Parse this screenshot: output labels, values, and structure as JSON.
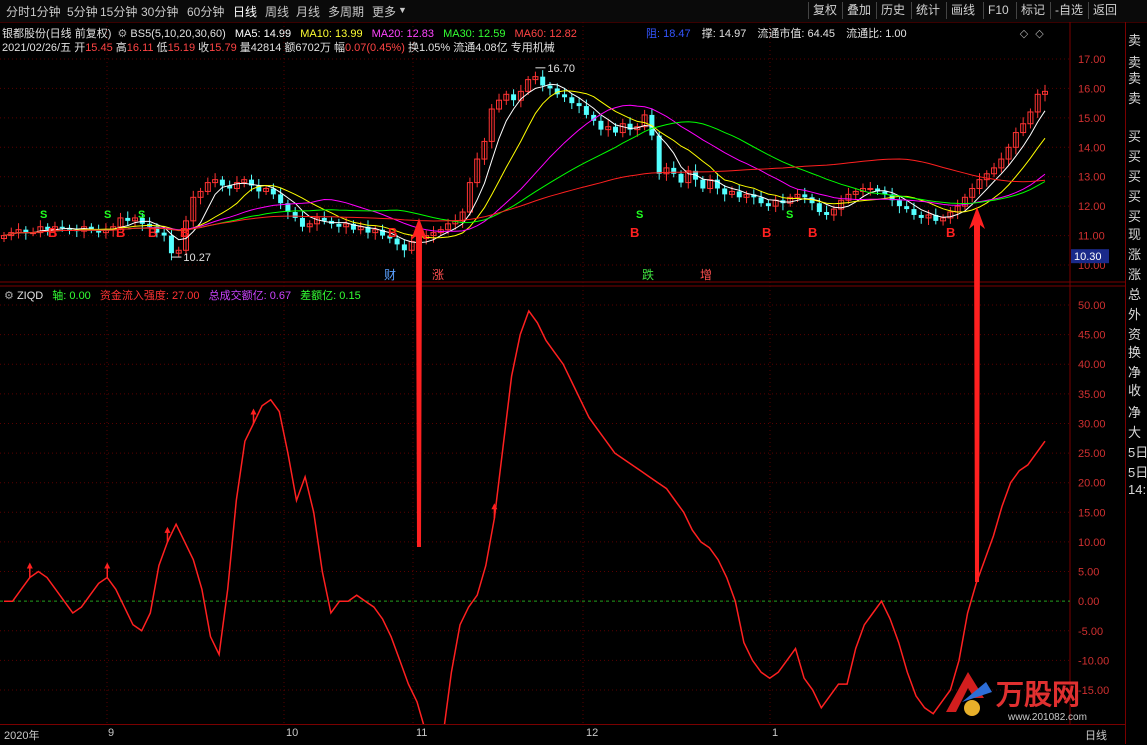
{
  "toolbar": {
    "periods": [
      "分时",
      "1分钟",
      "5分钟",
      "15分钟",
      "30分钟",
      "60分钟",
      "日线",
      "周线",
      "月线",
      "多周期",
      "更多"
    ],
    "active_period": "日线",
    "buttons": [
      "复权",
      "叠加",
      "历史",
      "统计",
      "画线",
      "F10",
      "标记",
      "-自选",
      "返回"
    ]
  },
  "header": {
    "stock_title": "银都股份(日线 前复权)",
    "bs5_label": "BS5(5,10,20,30,60)",
    "ma5": "MA5: 14.99",
    "ma10": "MA10: 13.99",
    "ma20": "MA20: 12.83",
    "ma30": "MA30: 12.59",
    "ma60": "MA60: 12.82",
    "resist": "阻: 18.47",
    "support": "撑: 14.97",
    "mktcap": "流通市值: 64.45",
    "circ_ratio": "流通比: 1.00",
    "date": "2021/02/26/五",
    "open_lbl": "开",
    "open": "15.45",
    "high_lbl": "高",
    "high": "16.11",
    "low_lbl": "低",
    "low": "15.19",
    "close_lbl": "收",
    "close": "15.79",
    "vol": "量42814",
    "amount": "额6702万",
    "chg_lbl": "幅",
    "chg": "0.07(0.45%)",
    "turnover": "换1.05%",
    "float": "流通4.08亿",
    "sector": "专用机械"
  },
  "indicator": {
    "name": "ZIQD",
    "axis": "轴: 0.00",
    "inflow": "资金流入强度: 27.00",
    "total": "总成交额亿: 0.67",
    "diff": "差额亿: 0.15"
  },
  "price_axis": [
    "17.00",
    "16.00",
    "15.00",
    "14.00",
    "13.00",
    "12.00",
    "11.00",
    "10.00"
  ],
  "current_price_tag": "10.30",
  "ind_axis": [
    "50.00",
    "45.00",
    "40.00",
    "35.00",
    "30.00",
    "25.00",
    "20.00",
    "15.00",
    "10.00",
    "5.00",
    "0.00",
    "-5.00",
    "-10.00",
    "-15.00"
  ],
  "date_axis": [
    "2020年",
    "9",
    "10",
    "11",
    "12",
    "1"
  ],
  "price_marks": {
    "high": "16.70",
    "low": "10.27"
  },
  "event_labels": [
    {
      "text": "财",
      "color": "#5aa0ff"
    },
    {
      "text": "涨",
      "color": "#ff5050"
    },
    {
      "text": "跌",
      "color": "#40e040"
    },
    {
      "text": "增",
      "color": "#ff5050"
    }
  ],
  "right_panel": [
    "卖",
    "卖",
    "卖",
    "卖",
    "买",
    "买",
    "买",
    "买",
    "买",
    "现",
    "涨",
    "涨",
    "总",
    "外",
    "资",
    "换",
    "净",
    "收",
    "净",
    "大",
    "5日",
    "5日",
    "14:"
  ],
  "bottom_tabs": [
    "日线"
  ],
  "logo_text": "万股网",
  "logo_url": "www.201082.com",
  "colors": {
    "up": "#ff3333",
    "down": "#54ffff",
    "ma5": "#ffffff",
    "ma10": "#ffff00",
    "ma20": "#ff00ff",
    "ma30": "#00ff00",
    "ma60": "#ff2020",
    "ziqd": "#ff2020",
    "grid": "#7a0000"
  },
  "chart_data": [
    {
      "type": "candlestick",
      "title": "银都股份(日线 前复权)",
      "yaxis_ticks": [
        17,
        16,
        15,
        14,
        13,
        12,
        11,
        10
      ],
      "ylim": [
        9.6,
        17.8
      ],
      "close_series": [
        11.0,
        11.1,
        11.2,
        11.1,
        11.1,
        11.3,
        11.2,
        11.3,
        11.25,
        11.2,
        11.15,
        11.3,
        11.2,
        11.1,
        11.2,
        11.3,
        11.6,
        11.5,
        11.6,
        11.4,
        11.3,
        11.1,
        11.0,
        10.4,
        10.5,
        11.5,
        12.3,
        12.5,
        12.8,
        12.9,
        12.7,
        12.6,
        12.8,
        12.9,
        12.7,
        12.5,
        12.6,
        12.4,
        12.1,
        11.8,
        11.6,
        11.3,
        11.4,
        11.6,
        11.5,
        11.4,
        11.3,
        11.4,
        11.2,
        11.3,
        11.1,
        11.2,
        11.0,
        10.9,
        10.7,
        10.5,
        10.8,
        10.9,
        11.0,
        11.1,
        11.2,
        11.4,
        11.5,
        11.8,
        12.8,
        13.6,
        14.2,
        15.3,
        15.6,
        15.8,
        15.6,
        15.9,
        16.3,
        16.4,
        16.1,
        16.0,
        15.8,
        15.7,
        15.5,
        15.4,
        15.1,
        14.9,
        14.6,
        14.7,
        14.5,
        14.8,
        14.6,
        14.7,
        15.1,
        14.4,
        13.1,
        13.3,
        13.1,
        12.8,
        13.2,
        12.9,
        12.6,
        12.9,
        12.6,
        12.4,
        12.5,
        12.3,
        12.4,
        12.3,
        12.1,
        12.0,
        12.2,
        12.1,
        12.3,
        12.4,
        12.3,
        12.1,
        11.8,
        11.7,
        11.9,
        12.2,
        12.4,
        12.5,
        12.6,
        12.6,
        12.5,
        12.4,
        12.2,
        12.0,
        11.9,
        11.7,
        11.6,
        11.7,
        11.5,
        11.6,
        11.8,
        12.0,
        12.3,
        12.6,
        12.9,
        13.1,
        13.3,
        13.6,
        14.0,
        14.5,
        14.8,
        15.2,
        15.8,
        15.9
      ],
      "ma_params": [
        5,
        10,
        20,
        30,
        60
      ],
      "annotations": [
        "16.70",
        "10.27"
      ]
    },
    {
      "type": "line",
      "title": "ZIQD",
      "series": [
        {
          "name": "资金流入强度",
          "values": [
            0,
            0,
            2,
            4,
            5,
            4,
            2,
            0,
            -2,
            -1,
            1,
            3,
            4,
            2,
            -1,
            -4,
            -5,
            -2,
            6,
            10,
            13,
            10,
            7,
            2,
            -6,
            -9,
            2,
            17,
            27,
            30,
            33,
            34,
            32,
            25,
            17,
            21,
            15,
            5,
            -2,
            0,
            0,
            1,
            0,
            -1,
            -3,
            -6,
            -10,
            -14,
            -17,
            -22,
            -25,
            -23,
            -12,
            -4,
            -1,
            1,
            6,
            14,
            26,
            38,
            45,
            49,
            47,
            44,
            42,
            40,
            37,
            34,
            31,
            29,
            27,
            25,
            24,
            23,
            22,
            21,
            20,
            19,
            17,
            15,
            12,
            10,
            9,
            7,
            4,
            0,
            -7,
            -10,
            -12,
            -13,
            -12,
            -10,
            -8,
            -13,
            -15,
            -18,
            -16,
            -14,
            -14,
            -8,
            -4,
            -2,
            0,
            -3,
            -7,
            -12,
            -16,
            -18,
            -19,
            -17,
            -15,
            -10,
            -2,
            3,
            7,
            11,
            16,
            20,
            22,
            23,
            25,
            27
          ]
        }
      ],
      "zero_line": 0,
      "ylim": [
        -20,
        55
      ],
      "yaxis_ticks": [
        50,
        45,
        40,
        35,
        30,
        25,
        20,
        15,
        10,
        5,
        0,
        -5,
        -10,
        -15
      ]
    }
  ]
}
